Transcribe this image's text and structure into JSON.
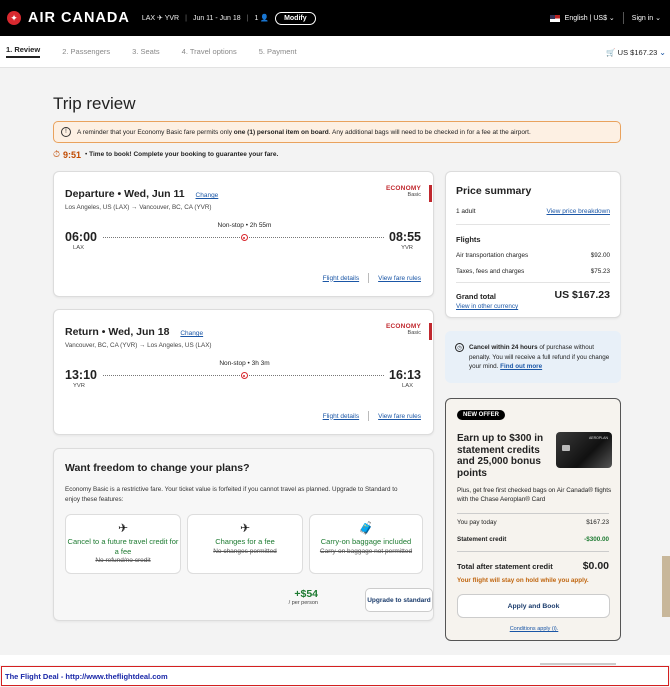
{
  "header": {
    "brand": "AIR CANADA",
    "route": "LAX ✈ YVR",
    "dates": "Jun 11 - Jun 18",
    "pax": "1 👤",
    "modify_label": "Modify",
    "language": "English | US$",
    "sign_in": "Sign in"
  },
  "steps": [
    {
      "label": "1.  Review"
    },
    {
      "label": "2.  Passengers"
    },
    {
      "label": "3.  Seats"
    },
    {
      "label": "4.  Travel options"
    },
    {
      "label": "5.  Payment"
    }
  ],
  "cart_total": "US $167.23",
  "page_title": "Trip review",
  "alert": {
    "prefix": "A reminder that your Economy Basic fare permits only ",
    "bold": "one (1) personal item on board",
    "suffix": ". Any additional bags will need to be checked in for a fee at the airport."
  },
  "timer": {
    "time": "9:51",
    "message": "Time to book! Complete your booking to guarantee your fare."
  },
  "departure": {
    "title": "Departure • Wed, Jun 11",
    "change": "Change",
    "route": "Los Angeles, US (LAX) → Vancouver, BC, CA (YVR)",
    "fare_class": "ECONOMY",
    "fare_sub": "Basic",
    "stops": "Non-stop • 2h 55m",
    "dep_time": "06:00",
    "arr_time": "08:55",
    "dep_code": "LAX",
    "arr_code": "YVR",
    "details": "Flight details",
    "rules": "View fare rules"
  },
  "return": {
    "title": "Return • Wed, Jun 18",
    "change": "Change",
    "route": "Vancouver, BC, CA (YVR) → Los Angeles, US (LAX)",
    "fare_class": "ECONOMY",
    "fare_sub": "Basic",
    "stops": "Non-stop • 3h 3m",
    "dep_time": "13:10",
    "arr_time": "16:13",
    "dep_code": "YVR",
    "arr_code": "LAX",
    "details": "Flight details",
    "rules": "View fare rules"
  },
  "flex": {
    "title": "Want freedom to change your plans?",
    "desc": "Economy Basic is a restrictive fare. Your ticket value is forfeited if you cannot travel as planned. Upgrade to Standard to enjoy these features:",
    "features": [
      {
        "icon": "✈",
        "label": "Cancel to a future travel credit for a fee",
        "strike": "No refund/no credit"
      },
      {
        "icon": "✈",
        "label": "Changes for a fee",
        "strike": "No changes permitted"
      },
      {
        "icon": "🧳",
        "label": "Carry-on baggage included",
        "strike": "Carry-on baggage not permitted"
      }
    ],
    "price": "+$54",
    "per": "/ per person",
    "upgrade": "Upgrade to standard"
  },
  "price_summary": {
    "title": "Price summary",
    "adult": "1 adult",
    "breakdown": "View price breakdown",
    "flights": "Flights",
    "air_label": "Air transportation charges",
    "air_value": "$92.00",
    "tax_label": "Taxes, fees and charges",
    "tax_value": "$75.23",
    "total_label": "Grand total",
    "total_value": "US $167.23",
    "currency": "View in other currency"
  },
  "cancel": {
    "bold": "Cancel within 24 hours",
    "text": " of purchase without penalty. You will receive a full refund if you change your mind. ",
    "link": "Find out more"
  },
  "offer": {
    "badge": "NEW OFFER",
    "title": "Earn up to $300 in statement credits and 25,000 bonus points",
    "card_brand": "AEROPLAN",
    "desc": "Plus, get free first checked bags on Air Canada® flights with the Chase Aeroplan® Card",
    "pay_label": "You pay today",
    "pay_value": "$167.23",
    "credit_label": "Statement credit",
    "credit_value": "-$300.00",
    "total_label": "Total after statement credit",
    "total_value": "$0.00",
    "hold": "Your flight will stay on hold while you apply.",
    "apply": "Apply and Book",
    "conditions": "Conditions apply (i)."
  },
  "banner": "The Flight Deal - http://www.theflightdeal.com"
}
